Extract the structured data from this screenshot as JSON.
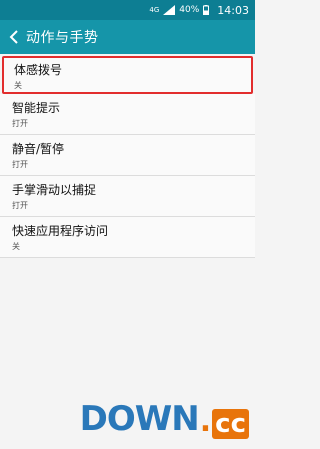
{
  "status_bar": {
    "network": "4G",
    "battery": "40%",
    "time": "14:03"
  },
  "header": {
    "title": "动作与手势"
  },
  "items": [
    {
      "title": "体感拨号",
      "subtitle": "关"
    },
    {
      "title": "智能提示",
      "subtitle": "打开"
    },
    {
      "title": "静音/暂停",
      "subtitle": "打开"
    },
    {
      "title": "手掌滑动以捕捉",
      "subtitle": "打开"
    },
    {
      "title": "快速应用程序访问",
      "subtitle": "关"
    }
  ],
  "watermark": {
    "main": "DOWN",
    "dot": ".",
    "suffix": "cc"
  },
  "colors": {
    "status_bar": "#0d7e93",
    "action_bar": "#1595a9",
    "highlight_border": "#e22d2d"
  }
}
